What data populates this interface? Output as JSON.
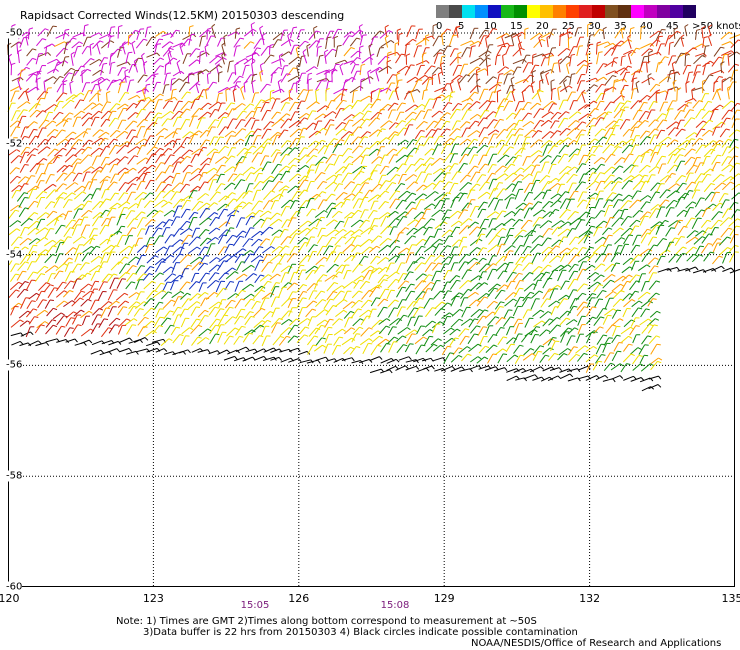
{
  "title": "Rapidsact Corrected Winds(12.5KM) 20150303 descending",
  "legend": {
    "colors": [
      "#7f7f7f",
      "#4a4a4a",
      "#00e0f0",
      "#0090ff",
      "#1010c0",
      "#18b818",
      "#009000",
      "#ffff00",
      "#ffc000",
      "#ff8000",
      "#ff4000",
      "#e02020",
      "#c00000",
      "#805020",
      "#603010",
      "#ff00ff",
      "#c000c0",
      "#8000a0",
      "#5000a0",
      "#200060"
    ],
    "labels": [
      "0",
      "5",
      "10",
      "15",
      "20",
      "25",
      "30",
      "35",
      "40",
      "45",
      ">50 knots"
    ]
  },
  "map": {
    "lon_ticks": [
      "120",
      "123",
      "126",
      "129",
      "132",
      "135"
    ],
    "lat_ticks": [
      "-50",
      "-52",
      "-54",
      "-56",
      "-58",
      "-60"
    ],
    "times": [
      "15:05",
      "15:08"
    ],
    "barb_colors": {
      "calm": "#000000",
      "blue": "#1030c0",
      "green": "#108c10",
      "yellow": "#f0e000",
      "orange": "#ffa000",
      "red": "#e03010",
      "darkred": "#b01010",
      "brown": "#804020",
      "magenta": "#d010d0"
    }
  },
  "notes": [
    "Note: 1) Times are GMT 2)Times along bottom correspond to measurement at ~50S",
    "3)Data buffer is 22 hrs from 20150303 4) Black circles indicate possible contamination"
  ],
  "credit": "NOAA/NESDIS/Office of Research and Applications"
}
